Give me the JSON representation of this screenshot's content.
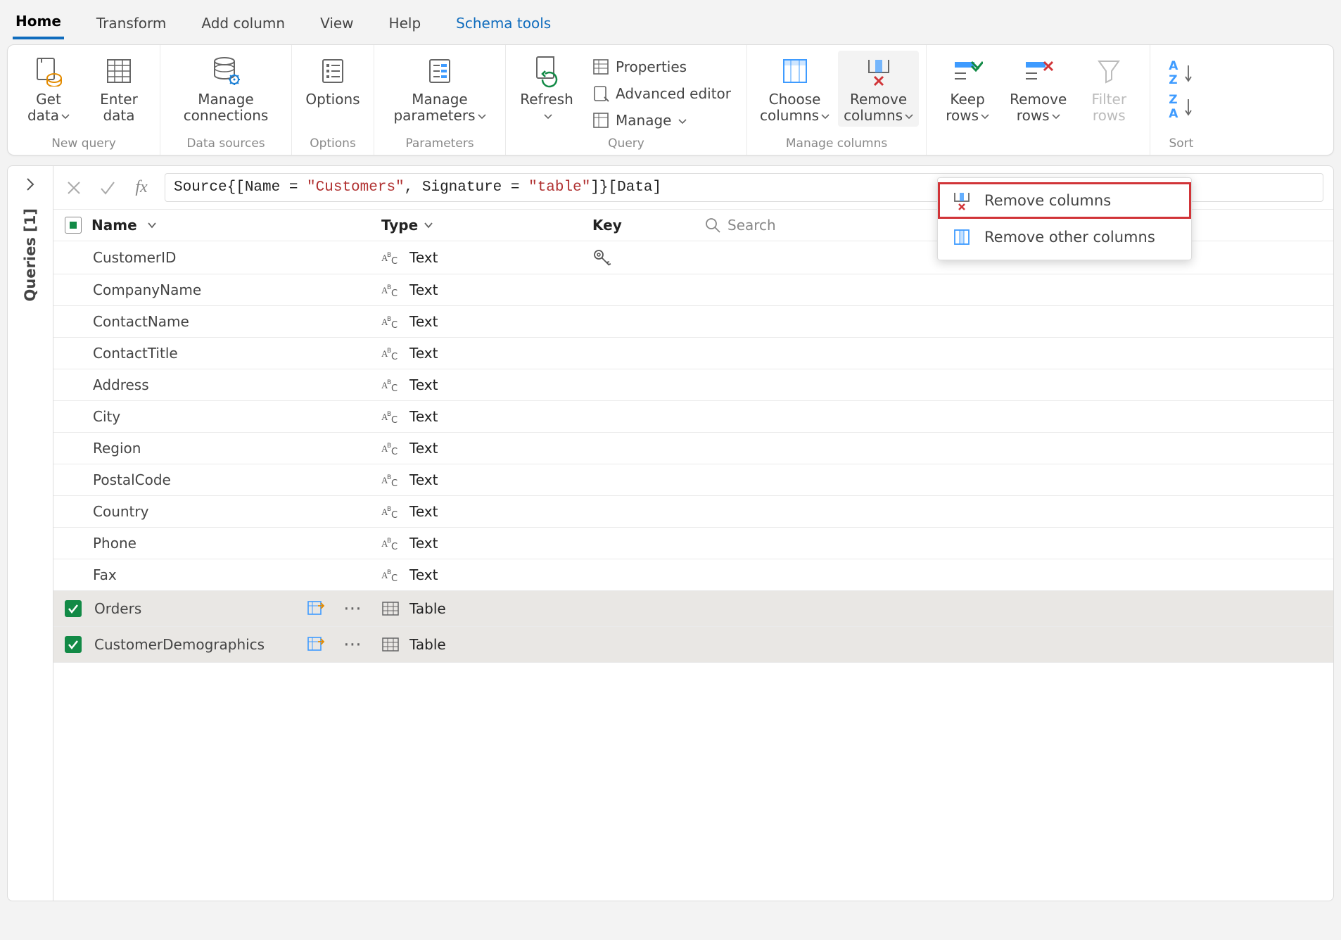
{
  "tabs": {
    "home": "Home",
    "transform": "Transform",
    "add_column": "Add column",
    "view": "View",
    "help": "Help",
    "schema_tools": "Schema tools"
  },
  "ribbon": {
    "new_query": {
      "label": "New query",
      "get_data": "Get\ndata",
      "enter_data": "Enter\ndata"
    },
    "data_sources": {
      "label": "Data sources",
      "manage_connections": "Manage\nconnections"
    },
    "options_group": {
      "label": "Options",
      "options": "Options"
    },
    "parameters_group": {
      "label": "Parameters",
      "manage_parameters": "Manage\nparameters"
    },
    "query_group": {
      "label": "Query",
      "refresh": "Refresh",
      "properties": "Properties",
      "advanced_editor": "Advanced editor",
      "manage": "Manage"
    },
    "manage_columns_group": {
      "label": "Manage columns",
      "choose_columns": "Choose\ncolumns",
      "remove_columns": "Remove\ncolumns"
    },
    "reduce_rows_group": {
      "label": "",
      "keep_rows": "Keep\nrows",
      "remove_rows": "Remove\nrows",
      "filter_rows": "Filter\nrows"
    },
    "sort_group": {
      "label": "Sort"
    }
  },
  "dropdown": {
    "remove_columns": "Remove columns",
    "remove_other_columns": "Remove other columns"
  },
  "formula": {
    "prefix": "Source{[Name = ",
    "s1": "\"Customers\"",
    "mid": ", Signature = ",
    "s2": "\"table\"",
    "suffix": "]}[Data]"
  },
  "side": {
    "queries_label": "Queries [1]"
  },
  "headers": {
    "name": "Name",
    "type": "Type",
    "key": "Key",
    "search_placeholder": "Search"
  },
  "type_labels": {
    "text": "Text",
    "table": "Table"
  },
  "rows": [
    {
      "name": "CustomerID",
      "type": "text",
      "key": true
    },
    {
      "name": "CompanyName",
      "type": "text"
    },
    {
      "name": "ContactName",
      "type": "text"
    },
    {
      "name": "ContactTitle",
      "type": "text"
    },
    {
      "name": "Address",
      "type": "text"
    },
    {
      "name": "City",
      "type": "text"
    },
    {
      "name": "Region",
      "type": "text"
    },
    {
      "name": "PostalCode",
      "type": "text"
    },
    {
      "name": "Country",
      "type": "text"
    },
    {
      "name": "Phone",
      "type": "text"
    },
    {
      "name": "Fax",
      "type": "text"
    },
    {
      "name": "Orders",
      "type": "table",
      "checked": true,
      "expandable": true
    },
    {
      "name": "CustomerDemographics",
      "type": "table",
      "checked": true,
      "expandable": true
    }
  ]
}
